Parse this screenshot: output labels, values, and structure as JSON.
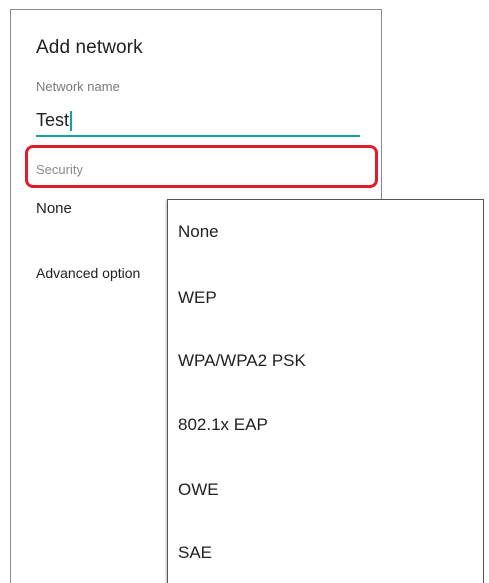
{
  "dialog": {
    "title": "Add network",
    "network_name": {
      "label": "Network name",
      "value": "Test"
    },
    "security": {
      "label": "Security",
      "selected": "None"
    },
    "advanced_options_label": "Advanced option"
  },
  "dropdown": {
    "items": [
      "None",
      "WEP",
      "WPA/WPA2 PSK",
      "802.1x EAP",
      "OWE",
      "SAE"
    ]
  },
  "colors": {
    "accent": "#14a39a",
    "highlight": "#e11d2b"
  }
}
